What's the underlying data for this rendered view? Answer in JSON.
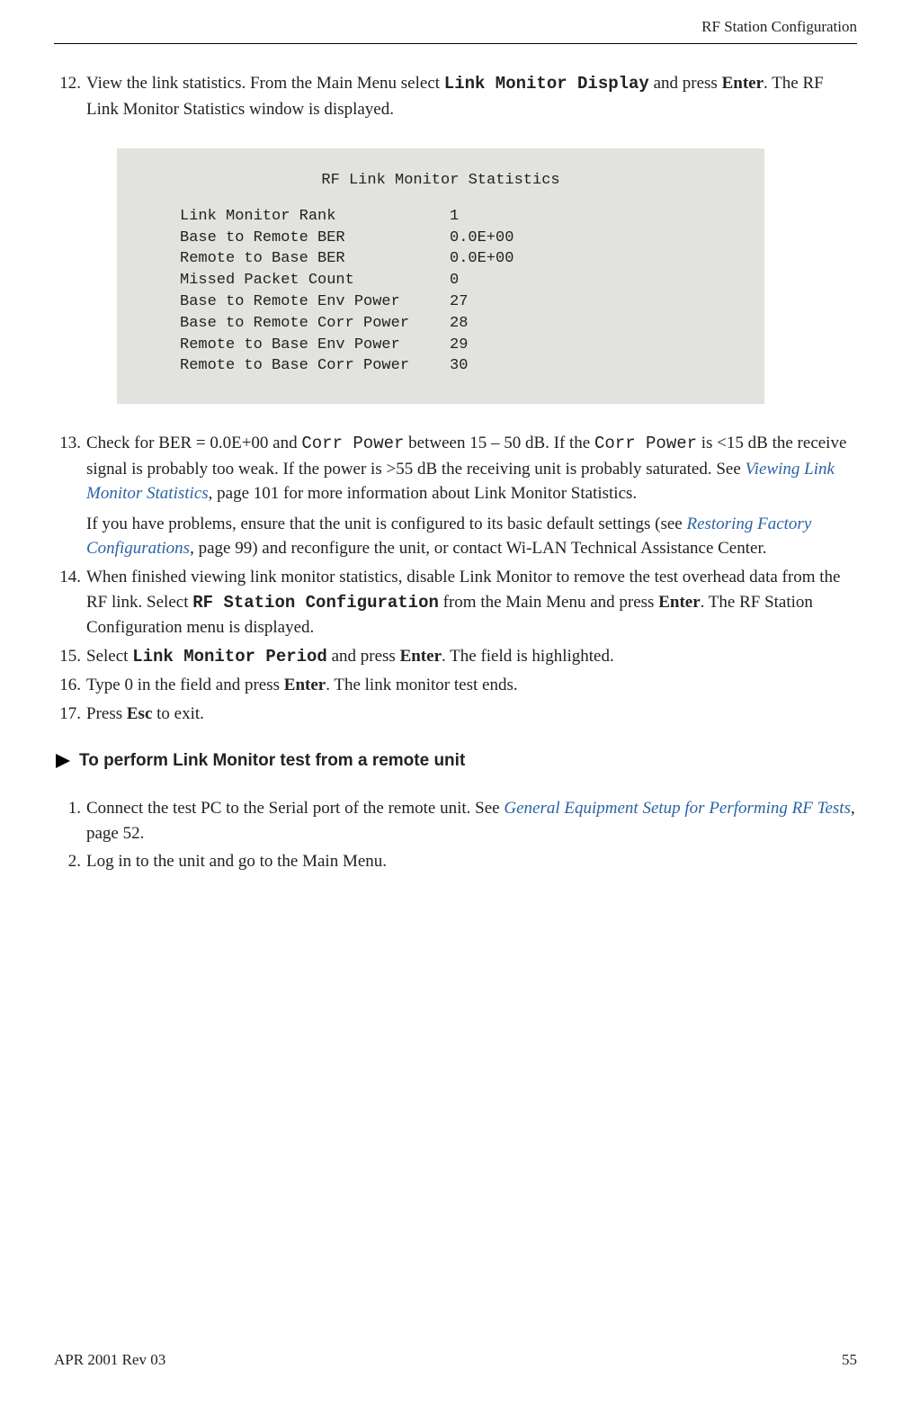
{
  "header": {
    "title": "RF Station Configuration"
  },
  "step12": {
    "num": "12.",
    "t1": "View the link statistics. From the Main Menu select ",
    "mono1": "Link Monitor Display",
    "t2": " and press ",
    "bold1": "Enter",
    "t3": ". The RF Link Monitor Statistics window is displayed."
  },
  "codeblock": {
    "title": "RF Link Monitor Statistics",
    "rows": [
      {
        "label": "Link Monitor Rank",
        "value": "1"
      },
      {
        "label": "Base to Remote BER",
        "value": "0.0E+00"
      },
      {
        "label": "Remote to Base BER",
        "value": "0.0E+00"
      },
      {
        "label": "Missed Packet Count",
        "value": "0"
      },
      {
        "label": "Base to Remote Env Power",
        "value": "27"
      },
      {
        "label": "Base to Remote Corr Power",
        "value": "28"
      },
      {
        "label": "Remote to Base Env Power",
        "value": "29"
      },
      {
        "label": "Remote to Base Corr Power",
        "value": "30"
      }
    ]
  },
  "step13": {
    "num": "13.",
    "t1": "Check for BER = 0.0E+00 and ",
    "mono1": "Corr Power",
    "t2": " between 15 – 50 dB. If the ",
    "mono2": "Corr Power",
    "t3": " is <15 dB the receive signal is probably too weak. If the power is >55 dB the receiving unit is probably saturated. See ",
    "link1": "Viewing Link Monitor Statistics",
    "t4": ", page 101 for more information about Link Monitor Statistics.",
    "p2a": "If you have problems, ensure that the unit is configured to its basic default settings (see ",
    "link2": "Restoring Factory Configurations",
    "p2b": ", page 99) and reconfigure the unit, or contact Wi-LAN Technical Assistance Center."
  },
  "step14": {
    "num": "14.",
    "t1": "When finished viewing link monitor statistics, disable Link Monitor to remove the test overhead data from the RF link. Select ",
    "mono1": "RF Station Configuration",
    "t2": " from the Main Menu and press ",
    "bold1": "Enter",
    "t3": ". The RF Station Configuration menu is displayed."
  },
  "step15": {
    "num": "15.",
    "t1": "Select ",
    "mono1": "Link Monitor Period",
    "t2": " and press ",
    "bold1": "Enter",
    "t3": ". The field is highlighted."
  },
  "step16": {
    "num": "16.",
    "t1": "Type 0 in the field and press ",
    "bold1": "Enter",
    "t2": ". The link monitor test ends."
  },
  "step17": {
    "num": "17.",
    "t1": "Press ",
    "bold1": "Esc",
    "t2": " to exit."
  },
  "heading": {
    "text": "To perform Link Monitor test from a remote unit"
  },
  "step1b": {
    "num": "1.",
    "t1": "Connect the test PC to the Serial port of the remote unit. See ",
    "link1": "General Equipment Setup for Performing RF Tests",
    "t2": ", page 52."
  },
  "step2b": {
    "num": "2.",
    "t1": "Log in to the unit and go to the Main Menu."
  },
  "footer": {
    "left": "APR 2001 Rev 03",
    "right": "55"
  }
}
